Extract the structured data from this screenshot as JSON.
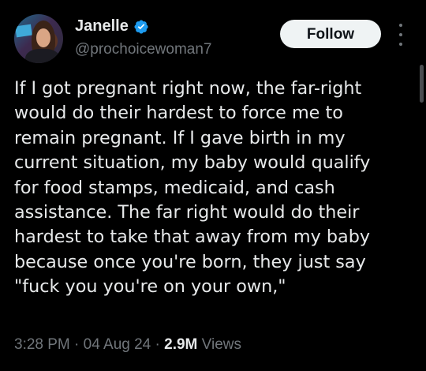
{
  "author": {
    "display_name": "Janelle",
    "handle": "@prochoicewoman7",
    "verified": true,
    "verified_icon": "verified-badge-icon",
    "verified_color": "#1d9bf0",
    "avatar": "profile-photo"
  },
  "actions": {
    "follow_label": "Follow",
    "more_icon": "vertical-ellipsis-icon"
  },
  "tweet": {
    "text": "If I got pregnant right now, the far-right\nwould do their hardest to force me to\nremain pregnant. If I gave birth in my\ncurrent situation, my baby would qualify\nfor food stamps, medicaid, and cash\nassistance. The far right would do their\nhardest to take that away from my baby\nbecause once you're born, they just say\n\"fuck you you're on your own,\""
  },
  "meta": {
    "time": "3:28 PM",
    "separator": " · ",
    "date": "04 Aug 24",
    "views_count": "2.9M",
    "views_label": "Views"
  },
  "colors": {
    "background": "#000000",
    "text_primary": "#e7e9ea",
    "text_secondary": "#71767b",
    "button_bg": "#eff3f4",
    "button_text": "#0f1419"
  }
}
